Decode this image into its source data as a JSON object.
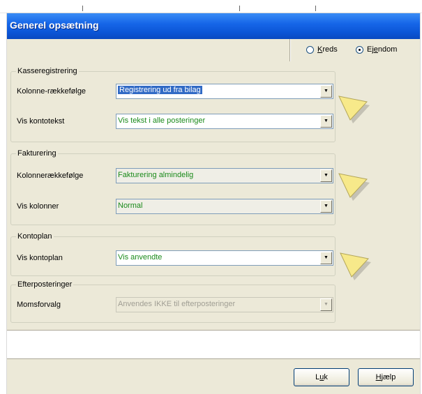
{
  "window": {
    "title": "Generel opsætning"
  },
  "mode": {
    "options": [
      {
        "label_pre": "",
        "label_accel": "K",
        "label_post": "reds",
        "selected": false
      },
      {
        "label_pre": "Ej",
        "label_accel": "e",
        "label_post": "ndom",
        "selected": true
      }
    ]
  },
  "groups": {
    "kasse": {
      "title": "Kasseregistrering",
      "rows": [
        {
          "label": "Kolonne-rækkefølge",
          "value": "Registrering ud fra bilag"
        },
        {
          "label": "Vis kontotekst",
          "value": "Vis tekst i alle posteringer"
        }
      ]
    },
    "fakt": {
      "title": "Fakturering",
      "rows": [
        {
          "label": "Kolonnerækkefølge",
          "value": "Fakturering almindelig"
        },
        {
          "label": "Vis kolonner",
          "value": "Normal"
        }
      ]
    },
    "konto": {
      "title": "Kontoplan",
      "rows": [
        {
          "label": "Vis kontoplan",
          "value": "Vis anvendte"
        }
      ]
    },
    "efter": {
      "title": "Efterposteringer",
      "rows": [
        {
          "label": "Momsforvalg",
          "value": "Anvendes IKKE til efterposteringer"
        }
      ]
    }
  },
  "buttons": {
    "close": {
      "pre": "L",
      "accel": "u",
      "post": "k"
    },
    "help": {
      "pre": "",
      "accel": "H",
      "post": "jælp"
    }
  },
  "colors": {
    "title_bar": "#0b55d6",
    "field_text": "#1a8a1a",
    "selection": "#316ac5",
    "pointer": "#f7e98a"
  },
  "icons": {
    "dropdown": "chevron-down-icon",
    "pointer": "yellow-arrow-pointer"
  }
}
